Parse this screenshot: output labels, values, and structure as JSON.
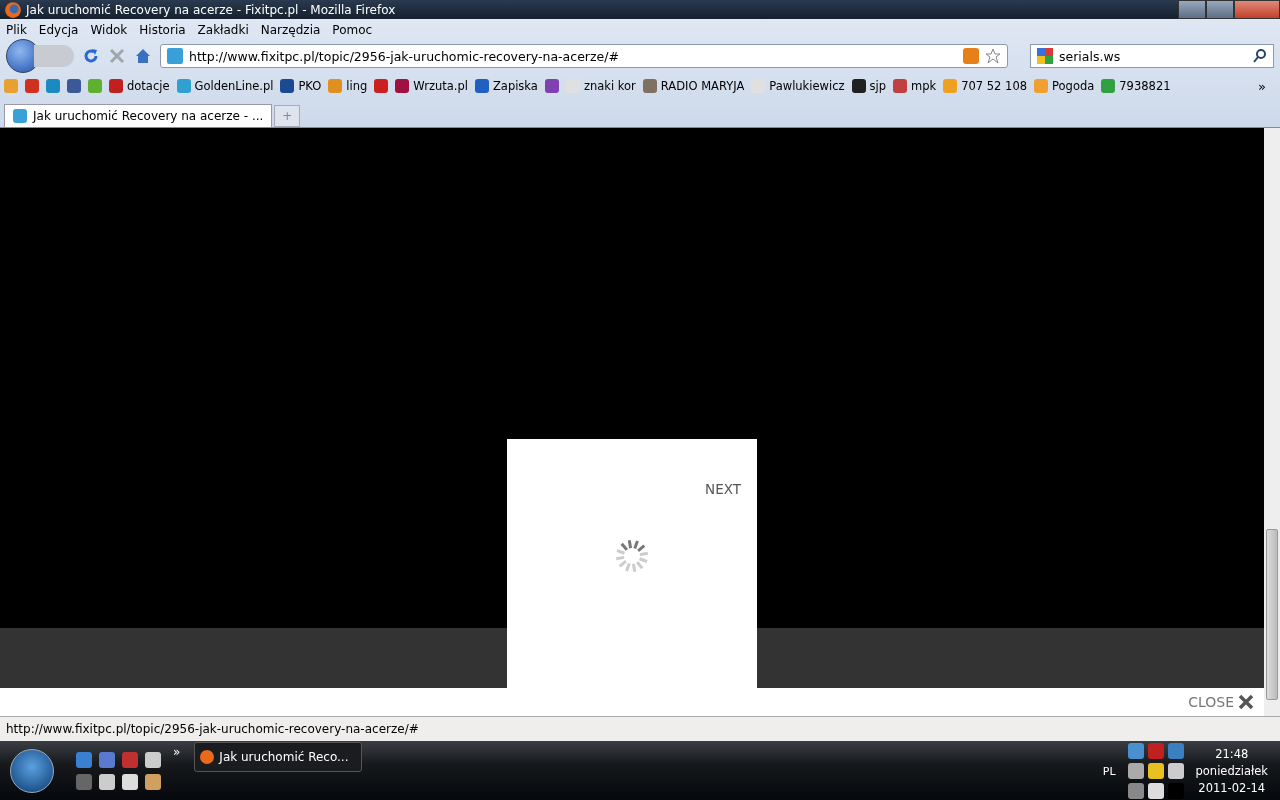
{
  "window": {
    "title": "Jak uruchomić Recovery na acerze - Fixitpc.pl - Mozilla Firefox"
  },
  "menu": [
    "Plik",
    "Edycja",
    "Widok",
    "Historia",
    "Zakładki",
    "Narzędzia",
    "Pomoc"
  ],
  "address_bar": {
    "value": "http://www.fixitpc.pl/topic/2956-jak-uruchomic-recovery-na-acerze/#"
  },
  "search": {
    "value": "serials.ws"
  },
  "bookmarks": [
    {
      "kind": "icon"
    },
    {
      "kind": "icon"
    },
    {
      "kind": "icon"
    },
    {
      "kind": "icon"
    },
    {
      "kind": "icon"
    },
    {
      "kind": "link",
      "label": "dotacje"
    },
    {
      "kind": "link",
      "label": "GoldenLine.pl"
    },
    {
      "kind": "link",
      "label": "PKO"
    },
    {
      "kind": "link",
      "label": "ling"
    },
    {
      "kind": "icon"
    },
    {
      "kind": "link",
      "label": "Wrzuta.pl"
    },
    {
      "kind": "link",
      "label": "Zapiska"
    },
    {
      "kind": "icon"
    },
    {
      "kind": "link",
      "label": "znaki kor"
    },
    {
      "kind": "link",
      "label": "RADIO MARYJA"
    },
    {
      "kind": "link",
      "label": "Pawlukiewicz"
    },
    {
      "kind": "link",
      "label": "sjp"
    },
    {
      "kind": "link",
      "label": "mpk"
    },
    {
      "kind": "link",
      "label": "707 52 108"
    },
    {
      "kind": "link",
      "label": "Pogoda"
    },
    {
      "kind": "link",
      "label": "7938821"
    }
  ],
  "bookmarks_more": "»",
  "tabs": [
    {
      "label": "Jak uruchomić Recovery na acerze - ...",
      "selected": true
    }
  ],
  "new_tab": "+",
  "lightbox": {
    "next": "NEXT",
    "close": "CLOSE"
  },
  "status_bar": "http://www.fixitpc.pl/topic/2956-jak-uruchomic-recovery-na-acerze/#",
  "taskbar": {
    "quick_launch_more": "»",
    "task": "Jak uruchomić Reco...",
    "language": "PL",
    "time": "21:48",
    "day": "poniedziałek",
    "date": "2011-02-14"
  }
}
